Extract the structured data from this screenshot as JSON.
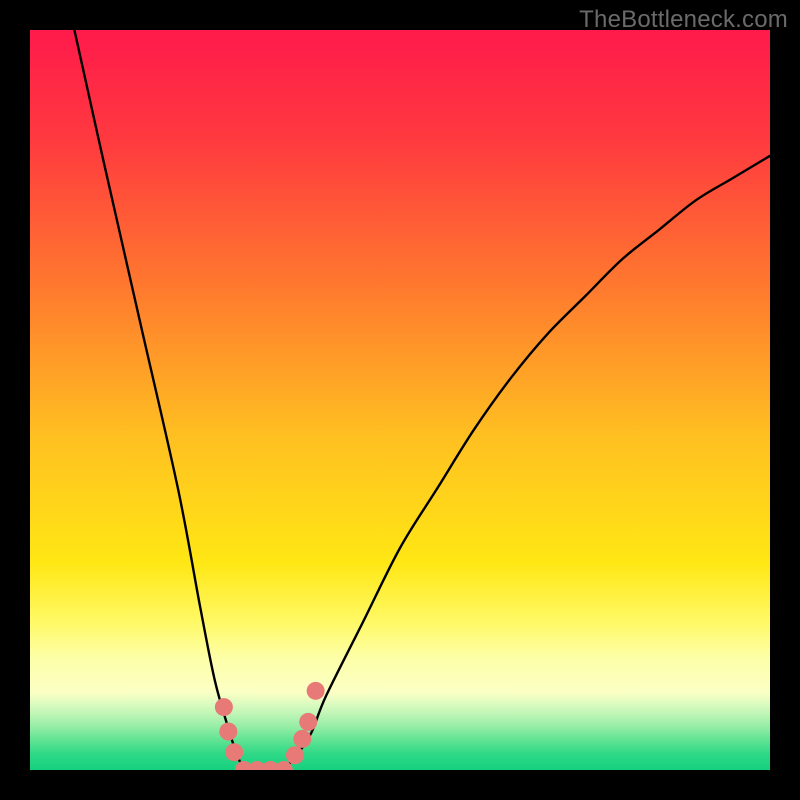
{
  "watermark": {
    "text": "TheBottleneck.com"
  },
  "chart_data": {
    "type": "line",
    "title": "",
    "xlabel": "",
    "ylabel": "",
    "xlim": [
      0,
      100
    ],
    "ylim": [
      0,
      100
    ],
    "series": [
      {
        "name": "bottleneck-curve",
        "x": [
          6,
          10,
          15,
          20,
          23,
          25,
          27,
          28,
          29,
          30,
          32,
          34,
          36,
          38,
          40,
          45,
          50,
          55,
          60,
          65,
          70,
          75,
          80,
          85,
          90,
          95,
          100
        ],
        "y": [
          100,
          82,
          60,
          38,
          22,
          12,
          5,
          2,
          0,
          0,
          0,
          0,
          2,
          5,
          10,
          20,
          30,
          38,
          46,
          53,
          59,
          64,
          69,
          73,
          77,
          80,
          83
        ]
      }
    ],
    "markers": {
      "name": "bottom-dots",
      "color": "#e77a76",
      "points": [
        {
          "x": 26.2,
          "y": 8.5
        },
        {
          "x": 26.8,
          "y": 5.2
        },
        {
          "x": 27.6,
          "y": 2.4
        },
        {
          "x": 28.9,
          "y": 0.0
        },
        {
          "x": 30.7,
          "y": 0.0
        },
        {
          "x": 32.5,
          "y": 0.0
        },
        {
          "x": 34.3,
          "y": 0.0
        },
        {
          "x": 35.8,
          "y": 2.0
        },
        {
          "x": 36.8,
          "y": 4.2
        },
        {
          "x": 37.6,
          "y": 6.5
        },
        {
          "x": 38.6,
          "y": 10.7
        }
      ]
    },
    "gradient": {
      "stops": [
        {
          "offset": 0.0,
          "color": "#ff1a4b"
        },
        {
          "offset": 0.15,
          "color": "#ff3a3f"
        },
        {
          "offset": 0.35,
          "color": "#ff7a2e"
        },
        {
          "offset": 0.55,
          "color": "#ffc021"
        },
        {
          "offset": 0.72,
          "color": "#ffe714"
        },
        {
          "offset": 0.8,
          "color": "#fff966"
        },
        {
          "offset": 0.85,
          "color": "#fdffa9"
        },
        {
          "offset": 0.895,
          "color": "#fbffc4"
        },
        {
          "offset": 0.912,
          "color": "#d9fbbf"
        },
        {
          "offset": 0.928,
          "color": "#b6f3b3"
        },
        {
          "offset": 0.944,
          "color": "#8eeca3"
        },
        {
          "offset": 0.96,
          "color": "#5fe393"
        },
        {
          "offset": 0.978,
          "color": "#2fd987"
        },
        {
          "offset": 1.0,
          "color": "#15d07e"
        }
      ]
    }
  }
}
